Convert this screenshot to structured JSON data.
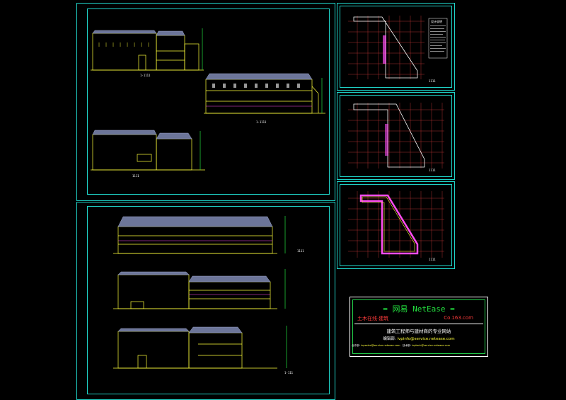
{
  "sheets": {
    "top_left": {
      "label_1": "1-1111",
      "label_2": "1-1111",
      "label_3": "1111"
    },
    "bottom_left": {
      "label_1": "1111",
      "label_2": "1-111"
    },
    "plan_1": {
      "legend_title": "设计说明",
      "label": "1111"
    },
    "plan_2": {
      "label": "1111"
    },
    "plan_3": {
      "label": "1111"
    }
  },
  "banner": {
    "title": "= 网易 NetEase =",
    "subtitle_left": "土木在线·建筑",
    "subtitle_right": "Co.163.com",
    "tagline": "建筑工程师与建材商的专业网站",
    "editor_label": "编辑部:",
    "editor_email": "ivpinfo@service.netease.com",
    "contact_1_label": "合作部:",
    "contact_1_email": "ivpsales@service.netease.com",
    "contact_2_label": "技术部:",
    "contact_2_email": "ivptech@service.netease.com"
  },
  "colors": {
    "frame": "#1fd3c8",
    "drawing_lines": "#ffff3b",
    "roof": "#9aa3c8",
    "accent_magenta": "#ff4df2",
    "accent_green": "#23e23f",
    "grid_red": "#d43a3a"
  }
}
